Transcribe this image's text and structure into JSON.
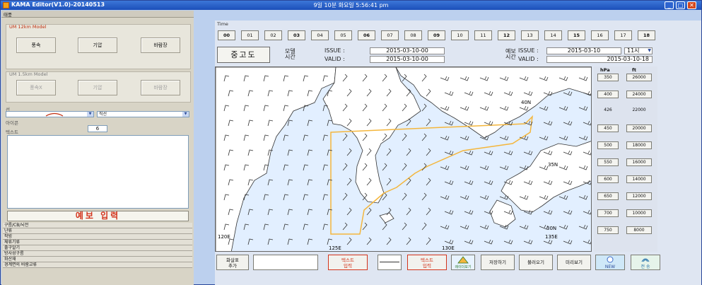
{
  "window": {
    "title": "KAMA Editor(V1.0)-20140513",
    "clock": "9일 10분  화요일  5:56:41 pm",
    "minimize": "_",
    "maximize": "□",
    "close": "✕"
  },
  "left": {
    "header": "태풍",
    "um12": {
      "title": "UM 12km Model",
      "buttons": [
        "풍속",
        "기압",
        "바람장"
      ]
    },
    "um15": {
      "title": "UM 1.5km Model",
      "buttons": [
        "풍속X",
        "기압",
        "바람장"
      ]
    },
    "line_label": "선",
    "line_combo_value": "",
    "line_style_value": "직선",
    "icon_label": "아이콘",
    "icon_value": "6",
    "text_label": "텍스트",
    "forecast_button": "예보 입력",
    "menu": [
      "구름/CB/뇌전",
      "난류",
      "착빙",
      "체류기류",
      "출구알기",
      "방사성구름",
      "화산재",
      "경계면의 바람교류"
    ]
  },
  "time": {
    "label": "Time",
    "hours": [
      "00",
      "01",
      "02",
      "03",
      "04",
      "05",
      "06",
      "07",
      "08",
      "09",
      "10",
      "11",
      "12",
      "13",
      "14",
      "15",
      "16",
      "17",
      "18"
    ],
    "bold_hours": [
      "00",
      "03",
      "06",
      "09",
      "12",
      "15",
      "18"
    ]
  },
  "info": {
    "notice": "중고도",
    "model_time_label": "모델\n시간",
    "forecast_time_label": "예보\n시간",
    "issue_label": "ISSUE :",
    "valid_label": "VALID :",
    "model_issue": "2015-03-10-00",
    "model_valid": "2015-03-10-00",
    "forecast_issue": "2015-03-10",
    "forecast_hour": "11시",
    "forecast_valid": "2015-03-10-18"
  },
  "map": {
    "labels": [
      "40N",
      "35N",
      "30N",
      "135E",
      "120E",
      "125E",
      "130E"
    ],
    "region_color": "#f4b63c",
    "sea_color": "#e2efff",
    "land_color": "#ffffff"
  },
  "levels": {
    "header_hpa": "hPa",
    "header_ft": "ft",
    "rows": [
      {
        "hpa": "350",
        "ft": "26000",
        "button": true
      },
      {
        "hpa": "400",
        "ft": "24000",
        "button": true
      },
      {
        "hpa": "426",
        "ft": "22000",
        "button": false
      },
      {
        "hpa": "450",
        "ft": "20000",
        "button": true
      },
      {
        "hpa": "500",
        "ft": "18000",
        "button": true
      },
      {
        "hpa": "550",
        "ft": "16000",
        "button": true
      },
      {
        "hpa": "600",
        "ft": "14000",
        "button": true
      },
      {
        "hpa": "650",
        "ft": "12000",
        "button": true
      },
      {
        "hpa": "700",
        "ft": "10000",
        "button": true
      },
      {
        "hpa": "750",
        "ft": "8000",
        "button": true
      }
    ]
  },
  "bottom": {
    "add_marker": "화살표\n추가",
    "text_input_1": "텍스트\n입력",
    "text_input_2": "텍스트\n입력",
    "chart_btn": "레이더보기",
    "save": "저장하기",
    "load": "불러오기",
    "preview": "미리보기",
    "new": "NEW",
    "send": "전 송"
  }
}
